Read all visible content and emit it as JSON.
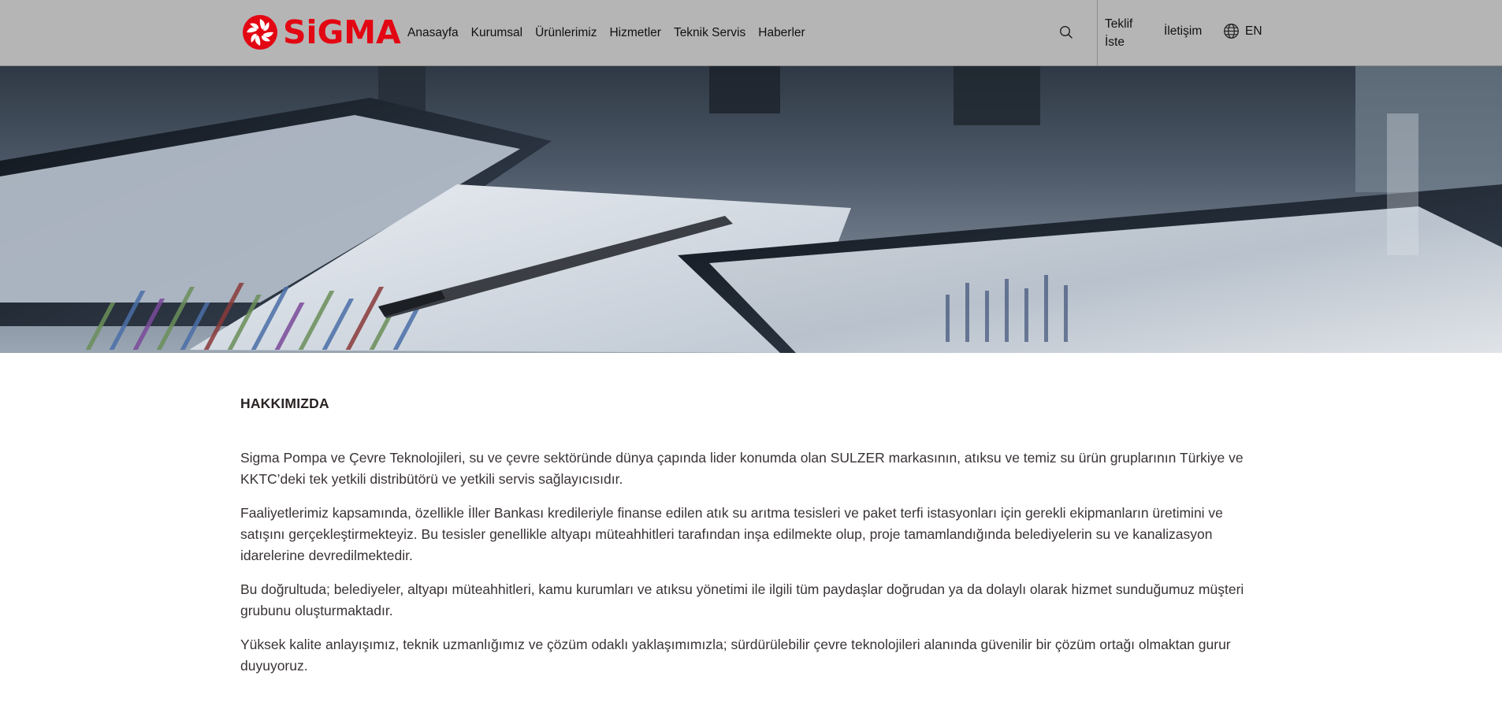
{
  "logo": {
    "text": "SiGMA",
    "color": "#e30613"
  },
  "nav": {
    "items": [
      {
        "label": "Anasayfa"
      },
      {
        "label": "Kurumsal"
      },
      {
        "label": "Ürünlerimiz"
      },
      {
        "label": "Hizmetler"
      },
      {
        "label": "Teknik Servis"
      },
      {
        "label": "Haberler"
      }
    ]
  },
  "header": {
    "search_icon": "search-icon",
    "quote_line1": "Teklif",
    "quote_line2": "İste",
    "contact_label": "İletişim",
    "language_icon": "globe-icon",
    "language_label": "EN",
    "background": "#b5b5b5"
  },
  "hero": {
    "description_icon": "banner-image"
  },
  "about": {
    "title": "HAKKIMIZDA",
    "paragraphs": [
      "Sigma Pompa ve Çevre Teknolojileri, su ve çevre sektöründe dünya çapında lider konumda olan SULZER markasının, atıksu ve temiz su ürün gruplarının Türkiye ve KKTC’deki tek yetkili distribütörü ve yetkili servis sağlayıcısıdır.",
      "Faaliyetlerimiz kapsamında, özellikle İller Bankası kredileriyle finanse edilen atık su arıtma tesisleri ve paket terfi istasyonları için gerekli ekipmanların üretimini ve satışını gerçekleştirmekteyiz. Bu tesisler genellikle altyapı müteahhitleri tarafından inşa edilmekte olup, proje tamamlandığında belediyelerin su ve kanalizasyon idarelerine devredilmektedir.",
      "Bu doğrultuda; belediyeler, altyapı müteahhitleri, kamu kurumları ve atıksu yönetimi ile ilgili tüm paydaşlar doğrudan ya da dolaylı olarak hizmet sunduğumuz müşteri grubunu oluşturmaktadır.",
      "Yüksek kalite anlayışımız, teknik uzmanlığımız ve çözüm odaklı yaklaşımımızla; sürdürülebilir çevre teknolojileri alanında güvenilir bir çözüm ortağı olmaktan gurur duyuyoruz."
    ]
  }
}
